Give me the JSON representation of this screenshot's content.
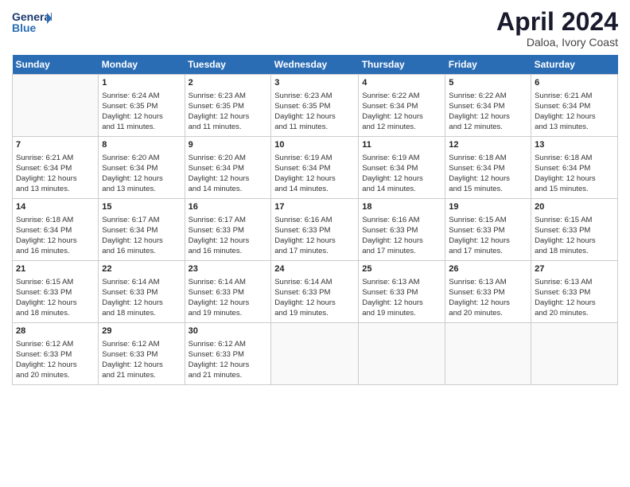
{
  "header": {
    "logo_line1": "General",
    "logo_line2": "Blue",
    "month": "April 2024",
    "location": "Daloa, Ivory Coast"
  },
  "days_of_week": [
    "Sunday",
    "Monday",
    "Tuesday",
    "Wednesday",
    "Thursday",
    "Friday",
    "Saturday"
  ],
  "weeks": [
    [
      {
        "day": "",
        "info": ""
      },
      {
        "day": "1",
        "info": "Sunrise: 6:24 AM\nSunset: 6:35 PM\nDaylight: 12 hours\nand 11 minutes."
      },
      {
        "day": "2",
        "info": "Sunrise: 6:23 AM\nSunset: 6:35 PM\nDaylight: 12 hours\nand 11 minutes."
      },
      {
        "day": "3",
        "info": "Sunrise: 6:23 AM\nSunset: 6:35 PM\nDaylight: 12 hours\nand 11 minutes."
      },
      {
        "day": "4",
        "info": "Sunrise: 6:22 AM\nSunset: 6:34 PM\nDaylight: 12 hours\nand 12 minutes."
      },
      {
        "day": "5",
        "info": "Sunrise: 6:22 AM\nSunset: 6:34 PM\nDaylight: 12 hours\nand 12 minutes."
      },
      {
        "day": "6",
        "info": "Sunrise: 6:21 AM\nSunset: 6:34 PM\nDaylight: 12 hours\nand 13 minutes."
      }
    ],
    [
      {
        "day": "7",
        "info": "Sunrise: 6:21 AM\nSunset: 6:34 PM\nDaylight: 12 hours\nand 13 minutes."
      },
      {
        "day": "8",
        "info": "Sunrise: 6:20 AM\nSunset: 6:34 PM\nDaylight: 12 hours\nand 13 minutes."
      },
      {
        "day": "9",
        "info": "Sunrise: 6:20 AM\nSunset: 6:34 PM\nDaylight: 12 hours\nand 14 minutes."
      },
      {
        "day": "10",
        "info": "Sunrise: 6:19 AM\nSunset: 6:34 PM\nDaylight: 12 hours\nand 14 minutes."
      },
      {
        "day": "11",
        "info": "Sunrise: 6:19 AM\nSunset: 6:34 PM\nDaylight: 12 hours\nand 14 minutes."
      },
      {
        "day": "12",
        "info": "Sunrise: 6:18 AM\nSunset: 6:34 PM\nDaylight: 12 hours\nand 15 minutes."
      },
      {
        "day": "13",
        "info": "Sunrise: 6:18 AM\nSunset: 6:34 PM\nDaylight: 12 hours\nand 15 minutes."
      }
    ],
    [
      {
        "day": "14",
        "info": "Sunrise: 6:18 AM\nSunset: 6:34 PM\nDaylight: 12 hours\nand 16 minutes."
      },
      {
        "day": "15",
        "info": "Sunrise: 6:17 AM\nSunset: 6:34 PM\nDaylight: 12 hours\nand 16 minutes."
      },
      {
        "day": "16",
        "info": "Sunrise: 6:17 AM\nSunset: 6:33 PM\nDaylight: 12 hours\nand 16 minutes."
      },
      {
        "day": "17",
        "info": "Sunrise: 6:16 AM\nSunset: 6:33 PM\nDaylight: 12 hours\nand 17 minutes."
      },
      {
        "day": "18",
        "info": "Sunrise: 6:16 AM\nSunset: 6:33 PM\nDaylight: 12 hours\nand 17 minutes."
      },
      {
        "day": "19",
        "info": "Sunrise: 6:15 AM\nSunset: 6:33 PM\nDaylight: 12 hours\nand 17 minutes."
      },
      {
        "day": "20",
        "info": "Sunrise: 6:15 AM\nSunset: 6:33 PM\nDaylight: 12 hours\nand 18 minutes."
      }
    ],
    [
      {
        "day": "21",
        "info": "Sunrise: 6:15 AM\nSunset: 6:33 PM\nDaylight: 12 hours\nand 18 minutes."
      },
      {
        "day": "22",
        "info": "Sunrise: 6:14 AM\nSunset: 6:33 PM\nDaylight: 12 hours\nand 18 minutes."
      },
      {
        "day": "23",
        "info": "Sunrise: 6:14 AM\nSunset: 6:33 PM\nDaylight: 12 hours\nand 19 minutes."
      },
      {
        "day": "24",
        "info": "Sunrise: 6:14 AM\nSunset: 6:33 PM\nDaylight: 12 hours\nand 19 minutes."
      },
      {
        "day": "25",
        "info": "Sunrise: 6:13 AM\nSunset: 6:33 PM\nDaylight: 12 hours\nand 19 minutes."
      },
      {
        "day": "26",
        "info": "Sunrise: 6:13 AM\nSunset: 6:33 PM\nDaylight: 12 hours\nand 20 minutes."
      },
      {
        "day": "27",
        "info": "Sunrise: 6:13 AM\nSunset: 6:33 PM\nDaylight: 12 hours\nand 20 minutes."
      }
    ],
    [
      {
        "day": "28",
        "info": "Sunrise: 6:12 AM\nSunset: 6:33 PM\nDaylight: 12 hours\nand 20 minutes."
      },
      {
        "day": "29",
        "info": "Sunrise: 6:12 AM\nSunset: 6:33 PM\nDaylight: 12 hours\nand 21 minutes."
      },
      {
        "day": "30",
        "info": "Sunrise: 6:12 AM\nSunset: 6:33 PM\nDaylight: 12 hours\nand 21 minutes."
      },
      {
        "day": "",
        "info": ""
      },
      {
        "day": "",
        "info": ""
      },
      {
        "day": "",
        "info": ""
      },
      {
        "day": "",
        "info": ""
      }
    ]
  ]
}
